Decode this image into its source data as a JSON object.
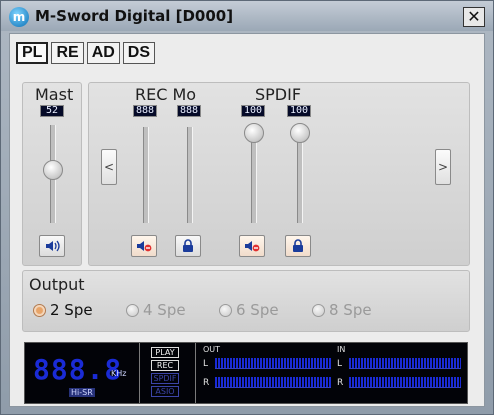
{
  "window": {
    "title": "M-Sword Digital [D000]",
    "logo_letter": "m",
    "close_label": "✕"
  },
  "tabs": [
    {
      "label": "PL",
      "active": true
    },
    {
      "label": "RE",
      "active": false
    },
    {
      "label": "AD",
      "active": false
    },
    {
      "label": "DS",
      "active": false
    }
  ],
  "master": {
    "label": "Mast",
    "level": "52",
    "level_fraction": 0.52,
    "mute_icon": "speaker-icon"
  },
  "mixer": {
    "rec_mon_label": "REC Mo",
    "spdif_label": "SPDIF",
    "rec_levels": [
      "888",
      "888"
    ],
    "spdif_levels": [
      "100",
      "100"
    ],
    "spdif_fraction": 1.0,
    "prev_label": "<",
    "next_label": ">"
  },
  "output": {
    "label": "Output",
    "options": [
      {
        "label": "2 Spe",
        "selected": true
      },
      {
        "label": "4 Spe",
        "selected": false
      },
      {
        "label": "6 Spe",
        "selected": false
      },
      {
        "label": "8 Spe",
        "selected": false
      }
    ]
  },
  "meter": {
    "frequency": "888.8",
    "unit": "KHz",
    "mode": "Hi-SR",
    "streams": [
      {
        "label": "PLAY",
        "active": true
      },
      {
        "label": "REC",
        "active": true
      },
      {
        "label": "SPDIF",
        "active": false
      },
      {
        "label": "ASIO",
        "active": false
      }
    ],
    "out_label": "OUT",
    "in_label": "IN",
    "left_label": "L",
    "right_label": "R"
  },
  "colors": {
    "accent_blue": "#1a2bd6",
    "panel_bg": "#ececec",
    "lcd_bg": "#050a28"
  }
}
